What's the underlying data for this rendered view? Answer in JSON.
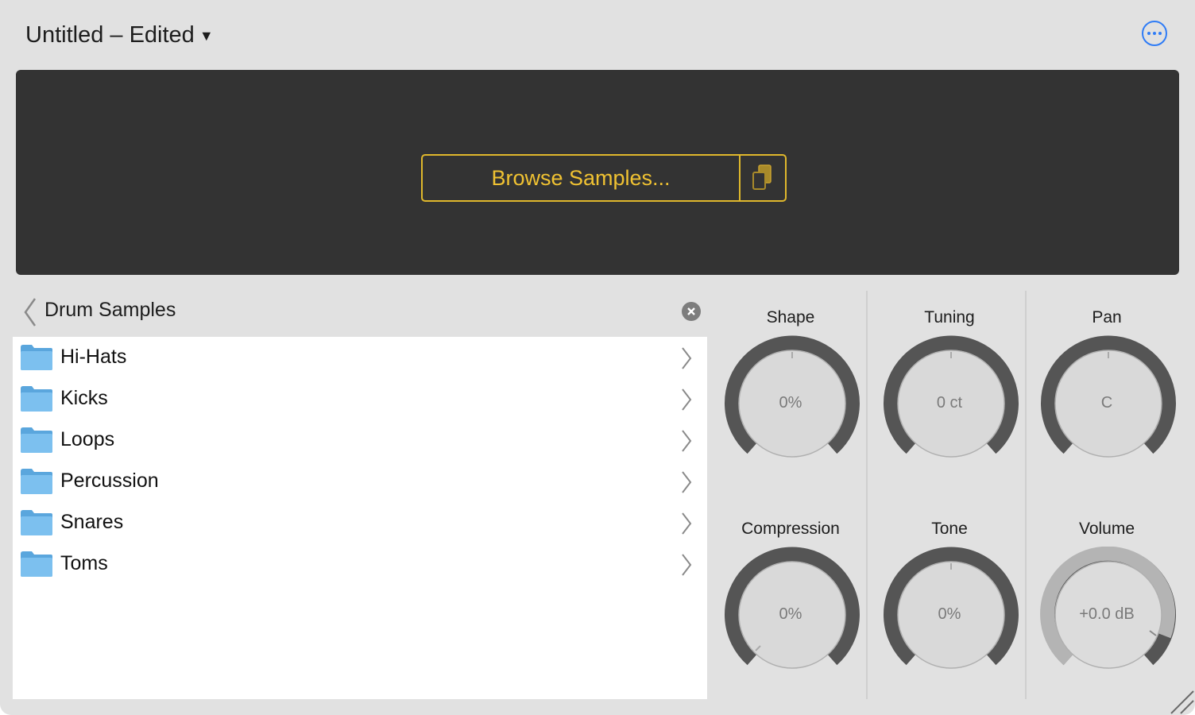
{
  "window": {
    "title": "Untitled – Edited"
  },
  "sample_area": {
    "browse_label": "Browse Samples..."
  },
  "browser": {
    "breadcrumb": "Drum Samples",
    "items": [
      {
        "label": "Hi-Hats"
      },
      {
        "label": "Kicks"
      },
      {
        "label": "Loops"
      },
      {
        "label": "Percussion"
      },
      {
        "label": "Snares"
      },
      {
        "label": "Toms"
      }
    ]
  },
  "controls": {
    "knobs": [
      {
        "label": "Shape",
        "value": "0%"
      },
      {
        "label": "Tuning",
        "value": "0 ct"
      },
      {
        "label": "Pan",
        "value": "C"
      },
      {
        "label": "Compression",
        "value": "0%"
      },
      {
        "label": "Tone",
        "value": "0%"
      },
      {
        "label": "Volume",
        "value": "+0.0 dB"
      }
    ]
  },
  "colors": {
    "accent": "#2f7cf6",
    "browse_yellow": "#f0c232",
    "folder_blue": "#6cb6ea"
  },
  "icons": [
    "chevron-down-icon",
    "more-icon",
    "paste-icon",
    "back-chevron-icon",
    "clear-icon",
    "folder-icon",
    "chevron-right-icon",
    "resize-grip-icon"
  ]
}
